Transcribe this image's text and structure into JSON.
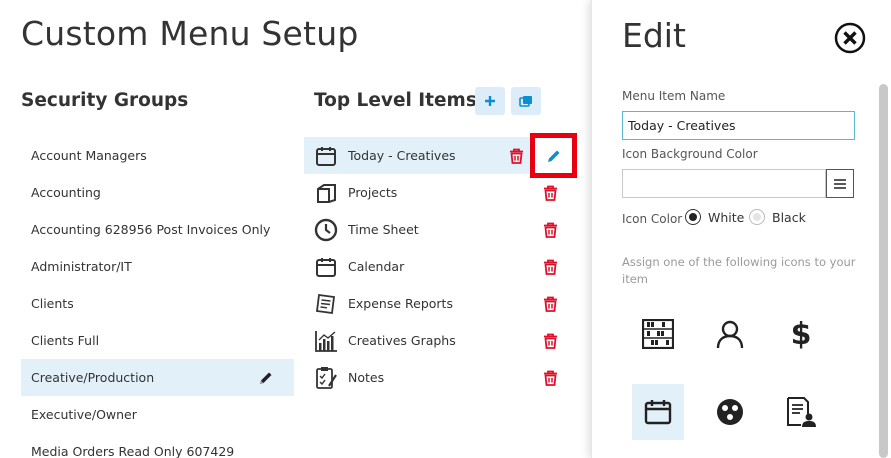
{
  "page": {
    "title": "Custom Menu Setup"
  },
  "security_groups": {
    "title": "Security Groups",
    "items": [
      {
        "label": "Account Managers"
      },
      {
        "label": "Accounting"
      },
      {
        "label": "Accounting 628956 Post Invoices Only"
      },
      {
        "label": "Administrator/IT"
      },
      {
        "label": "Clients"
      },
      {
        "label": "Clients Full"
      },
      {
        "label": "Creative/Production",
        "selected": true
      },
      {
        "label": "Executive/Owner"
      },
      {
        "label": "Media Orders Read Only 607429"
      }
    ]
  },
  "top_level": {
    "title": "Top Level Items",
    "items": [
      {
        "label": "Today - Creatives",
        "icon": "calendar-icon",
        "selected": true
      },
      {
        "label": "Projects",
        "icon": "projects-icon"
      },
      {
        "label": "Time Sheet",
        "icon": "clock-icon"
      },
      {
        "label": "Calendar",
        "icon": "calendar-icon"
      },
      {
        "label": "Expense Reports",
        "icon": "receipt-icon"
      },
      {
        "label": "Creatives Graphs",
        "icon": "bar-chart-icon"
      },
      {
        "label": "Notes",
        "icon": "clipboard-icon"
      }
    ]
  },
  "edit_panel": {
    "title": "Edit",
    "name_label": "Menu Item Name",
    "name_value": "Today - Creatives",
    "bg_color_label": "Icon Background Color",
    "icon_color_label": "Icon Color",
    "white_label": "White",
    "black_label": "Black",
    "selected_icon_color": "White",
    "help_text": "Assign one of the following icons to your item",
    "icon_choices": [
      "abacus-icon",
      "user-icon",
      "dollar-icon",
      "calendar-icon",
      "palette-icon",
      "document-person-icon"
    ],
    "selected_icon": "calendar-icon"
  },
  "colors": {
    "accent": "#0a8fd0",
    "trash": "#e0102a",
    "highlight_box": "#e8000e",
    "selection_bg": "#e2f0fa"
  }
}
